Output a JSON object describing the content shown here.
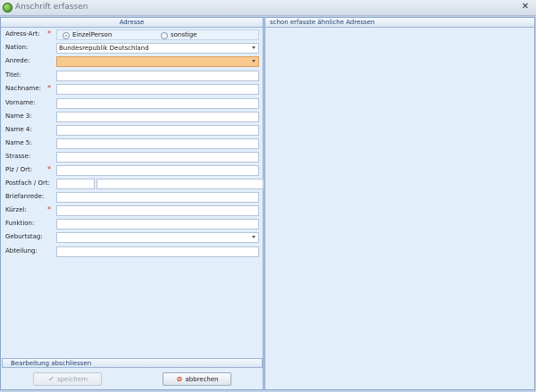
{
  "window": {
    "title": "Anschrift erfassen",
    "close_glyph": "✕"
  },
  "left_panel": {
    "header": "Adresse",
    "fields": {
      "adress_art": {
        "label": "Adress-Art:",
        "required": "*",
        "options": [
          "EinzelPerson",
          "sonstige"
        ],
        "selected": "EinzelPerson"
      },
      "nation": {
        "label": "Nation:",
        "value": "Bundesrepublik Deutschland"
      },
      "anrede": {
        "label": "Anrede:",
        "value": ""
      },
      "titel": {
        "label": "Titel:",
        "value": ""
      },
      "nachname": {
        "label": "Nachname:",
        "required": "*",
        "value": ""
      },
      "vorname": {
        "label": "Vorname:",
        "value": ""
      },
      "name3": {
        "label": "Name 3:",
        "value": ""
      },
      "name4": {
        "label": "Name 4:",
        "value": ""
      },
      "name5": {
        "label": "Name 5:",
        "value": ""
      },
      "strasse": {
        "label": "Strasse:",
        "value": ""
      },
      "plz_ort": {
        "label": "Plz / Ort:",
        "required": "*",
        "value": ""
      },
      "postfach_ort": {
        "label": "Postfach / Ort:",
        "postfach": "",
        "ort": ""
      },
      "briefanrede": {
        "label": "Briefanrede:",
        "value": ""
      },
      "kuerzel": {
        "label": "Kürzel:",
        "required": "*",
        "value": ""
      },
      "funktion": {
        "label": "Funktion:",
        "value": ""
      },
      "geburtstag": {
        "label": "Geburtstag:",
        "value": ""
      },
      "abteilung": {
        "label": "Abteilung:",
        "value": ""
      }
    },
    "footer_bar": "Bearbeitung abschliessen",
    "buttons": {
      "save": "speichern",
      "cancel": "abbrechen"
    }
  },
  "right_panel": {
    "header": "schon erfasste ähnliche Adressen"
  },
  "icons": {
    "app": "app-icon",
    "check": "check-icon",
    "stop": "stop-icon"
  },
  "colors": {
    "focus_field": "#f9c98e",
    "required_star": "#d2331c",
    "panel_bg": "#e3eefb"
  }
}
